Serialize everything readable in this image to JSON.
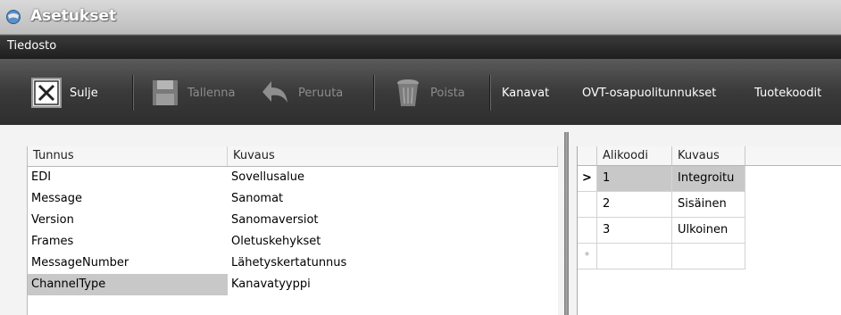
{
  "window": {
    "title": "Asetukset"
  },
  "menu": {
    "file": "Tiedosto"
  },
  "toolbar": {
    "close": "Sulje",
    "save": "Tallenna",
    "undo": "Peruuta",
    "delete": "Poista",
    "channels": "Kanavat",
    "parties": "OVT-osapuolitunnukset",
    "product_codes": "Tuotekoodit"
  },
  "left_table": {
    "columns": [
      "Tunnus",
      "Kuvaus"
    ],
    "rows": [
      [
        "EDI",
        "Sovellusalue"
      ],
      [
        "Message",
        "Sanomat"
      ],
      [
        "Version",
        "Sanomaversiot"
      ],
      [
        "Frames",
        "Oletuskehykset"
      ],
      [
        "MessageNumber",
        "Lähetyskertatunnus"
      ],
      [
        "ChannelType",
        "Kanavatyyppi"
      ]
    ],
    "selected_row": 5
  },
  "right_table": {
    "columns": [
      "Alikoodi",
      "Kuvaus"
    ],
    "current_marker": ">",
    "new_row_marker": "*",
    "rows": [
      [
        "1",
        "Integroitu"
      ],
      [
        "2",
        "Sisäinen"
      ],
      [
        "3",
        "Ulkoinen"
      ]
    ]
  }
}
